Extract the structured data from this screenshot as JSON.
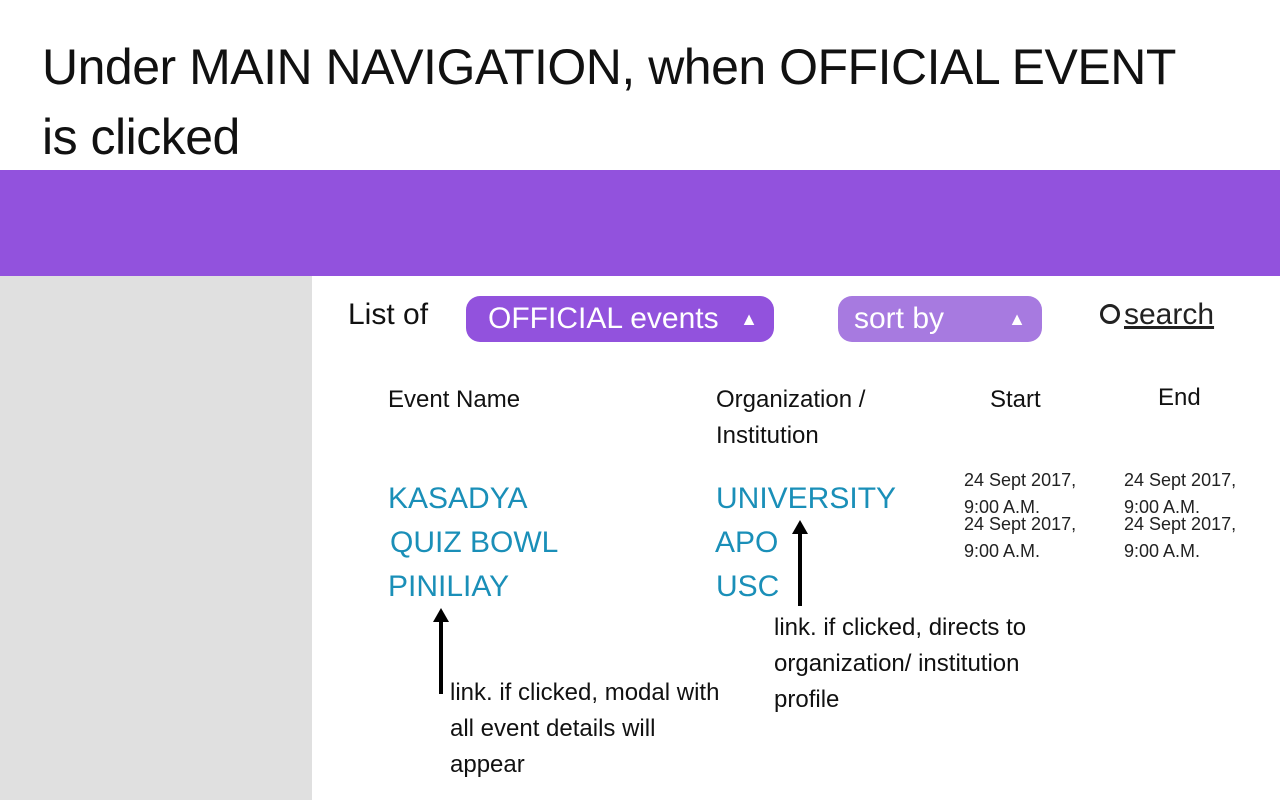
{
  "heading": {
    "line1": "Under MAIN NAVIGATION,  when OFFICIAL EVENT",
    "line2": "is clicked"
  },
  "toolbar": {
    "list_of_label": "List of",
    "events_dropdown": {
      "value": "OFFICIAL events",
      "icon": "triangle-up"
    },
    "sort_dropdown": {
      "value": "sort by",
      "icon": "triangle-up"
    },
    "search_icon": "search-icon",
    "search_label": "search"
  },
  "columns": {
    "event_name": "Event Name",
    "organization_line1": "Organization /",
    "organization_line2": "Institution",
    "start": "Start",
    "end": "End"
  },
  "rows": [
    {
      "event": "KASADYA",
      "organization": "UNIVERSITY",
      "start": {
        "date": "24 Sept 2017,",
        "time": "9:00 A.M."
      },
      "end": {
        "date": "24 Sept 2017,",
        "time": "9:00 A.M."
      }
    },
    {
      "event": "QUIZ BOWL",
      "organization": "APO",
      "start": {
        "date": "24 Sept 2017,",
        "time": "9:00 A.M."
      },
      "end": {
        "date": "24 Sept 2017,",
        "time": "9:00 A.M."
      }
    },
    {
      "event": "PINILIAY",
      "organization": "USC"
    }
  ],
  "notes": {
    "org_link": [
      "link. if clicked, directs to",
      "organization/ institution",
      "profile"
    ],
    "event_link": [
      "link. if clicked, modal with",
      "all event details will",
      "appear"
    ]
  },
  "colors": {
    "accent": "#9252dd",
    "sort_pill": "#a77ae0",
    "link": "#1a8fb8",
    "sidebar": "#e0e0e0"
  }
}
